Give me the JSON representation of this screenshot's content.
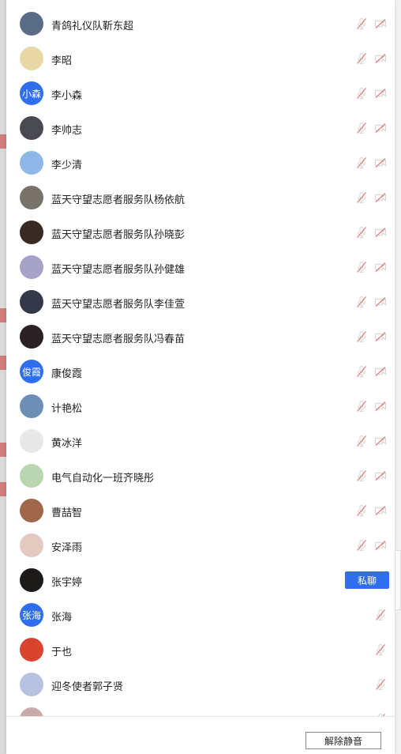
{
  "members": [
    {
      "name": "青鸽礼仪队靳东超",
      "avatar": {
        "type": "photo",
        "color": "#5b6d86"
      },
      "mic_muted": true,
      "cam_off": true
    },
    {
      "name": "李昭",
      "avatar": {
        "type": "photo",
        "color": "#e9d8a6"
      },
      "mic_muted": true,
      "cam_off": true
    },
    {
      "name": "李小森",
      "avatar": {
        "type": "text",
        "text": "小森",
        "color": "#2f6fed"
      },
      "mic_muted": true,
      "cam_off": true
    },
    {
      "name": "李帅志",
      "avatar": {
        "type": "photo",
        "color": "#4a4a52"
      },
      "mic_muted": true,
      "cam_off": true
    },
    {
      "name": "李少清",
      "avatar": {
        "type": "photo",
        "color": "#8fb8e8"
      },
      "mic_muted": true,
      "cam_off": true
    },
    {
      "name": "蓝天守望志愿者服务队杨依航",
      "avatar": {
        "type": "photo",
        "color": "#77726a"
      },
      "mic_muted": true,
      "cam_off": true
    },
    {
      "name": "蓝天守望志愿者服务队孙晓彭",
      "avatar": {
        "type": "photo",
        "color": "#3a2a24"
      },
      "mic_muted": true,
      "cam_off": true
    },
    {
      "name": "蓝天守望志愿者服务队孙健雄",
      "avatar": {
        "type": "photo",
        "color": "#a7a3c8"
      },
      "mic_muted": true,
      "cam_off": true
    },
    {
      "name": "蓝天守望志愿者服务队李佳萱",
      "avatar": {
        "type": "photo",
        "color": "#34394a"
      },
      "mic_muted": true,
      "cam_off": true
    },
    {
      "name": "蓝天守望志愿者服务队冯春苗",
      "avatar": {
        "type": "photo",
        "color": "#2a2224"
      },
      "mic_muted": true,
      "cam_off": true
    },
    {
      "name": "康俊霞",
      "avatar": {
        "type": "text",
        "text": "俊霞",
        "color": "#2f6fed"
      },
      "mic_muted": true,
      "cam_off": true
    },
    {
      "name": "计艳松",
      "avatar": {
        "type": "photo",
        "color": "#6d8fb5"
      },
      "mic_muted": true,
      "cam_off": true
    },
    {
      "name": "黄冰洋",
      "avatar": {
        "type": "photo",
        "color": "#e8e8e8"
      },
      "mic_muted": true,
      "cam_off": true
    },
    {
      "name": "电气自动化一班齐晓彤",
      "avatar": {
        "type": "photo",
        "color": "#b9d6b0"
      },
      "mic_muted": true,
      "cam_off": true
    },
    {
      "name": "曹喆智",
      "avatar": {
        "type": "photo",
        "color": "#a0674a"
      },
      "mic_muted": true,
      "cam_off": true
    },
    {
      "name": "安泽雨",
      "avatar": {
        "type": "photo",
        "color": "#e3c9c0"
      },
      "mic_muted": true,
      "cam_off": true
    },
    {
      "name": "张宇婷",
      "avatar": {
        "type": "photo",
        "color": "#1e1a1a"
      },
      "private_chat": "私聊"
    },
    {
      "name": "张海",
      "avatar": {
        "type": "text",
        "text": "张海",
        "color": "#2f6fed"
      },
      "mic_muted": true
    },
    {
      "name": "于也",
      "avatar": {
        "type": "photo",
        "color": "#d9432f"
      },
      "mic_muted": true
    },
    {
      "name": "迎冬使者郭子贤",
      "avatar": {
        "type": "photo",
        "color": "#b7c2e0"
      },
      "mic_muted": true
    },
    {
      "name": "",
      "avatar": {
        "type": "photo",
        "color": "#c9a9a9"
      },
      "mic_muted": true
    }
  ],
  "footer": {
    "unmute_all_label": "解除静音"
  },
  "colors": {
    "accent": "#2f6fed",
    "muted_icon": "#d8d8d8",
    "muted_slash": "#e07a7a"
  }
}
